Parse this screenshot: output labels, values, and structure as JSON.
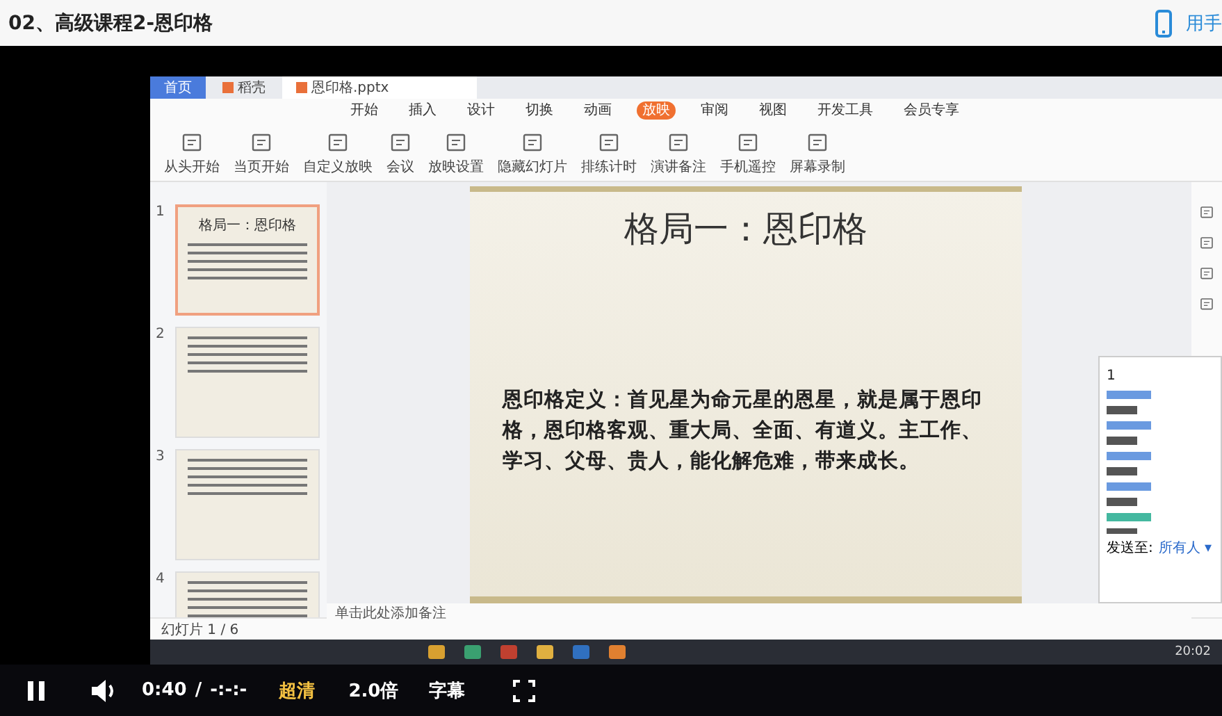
{
  "header": {
    "title": "02、高级课程2-恩印格",
    "mobile_link": "用手"
  },
  "recording": {
    "doc_tabs": [
      {
        "label": "首页",
        "selected": false
      },
      {
        "label": "稻壳",
        "selected": false
      },
      {
        "label": "恩印格.pptx",
        "selected": true
      }
    ],
    "ribbon_tabs": [
      {
        "label": "开始",
        "selected": false
      },
      {
        "label": "插入",
        "selected": false
      },
      {
        "label": "设计",
        "selected": false
      },
      {
        "label": "切换",
        "selected": false
      },
      {
        "label": "动画",
        "selected": false
      },
      {
        "label": "放映",
        "selected": true
      },
      {
        "label": "审阅",
        "selected": false
      },
      {
        "label": "视图",
        "selected": false
      },
      {
        "label": "开发工具",
        "selected": false
      },
      {
        "label": "会员专享",
        "selected": false
      }
    ],
    "tools": [
      "从头开始",
      "当页开始",
      "自定义放映",
      "会议",
      "放映设置",
      "隐藏幻灯片",
      "排练计时",
      "演讲备注",
      "手机遥控",
      "屏幕录制"
    ],
    "thumbnails": [
      {
        "number": "1",
        "title": "格局一：恩印格",
        "selected": true
      },
      {
        "number": "2",
        "selected": false
      },
      {
        "number": "3",
        "selected": false
      },
      {
        "number": "4",
        "selected": false
      }
    ],
    "slide": {
      "title": "格局一：恩印格",
      "body": "恩印格定义：首见星为命元星的恩星，就是属于恩印格，恩印格客观、重大局、全面、有道义。主工作、学习、父母、贵人，能化解危难，带来成长。"
    },
    "notes_placeholder": "单击此处添加备注",
    "status": "幻灯片 1 / 6",
    "chat": {
      "first_line": "1",
      "send_label": "发送至:",
      "send_to": "所有人 ▾"
    },
    "clock": "20:02"
  },
  "player": {
    "playing": true,
    "time": "0:40",
    "separator": "/",
    "duration": "-:-:-",
    "quality": "超清",
    "speed": "2.0倍",
    "subtitles": "字幕"
  }
}
